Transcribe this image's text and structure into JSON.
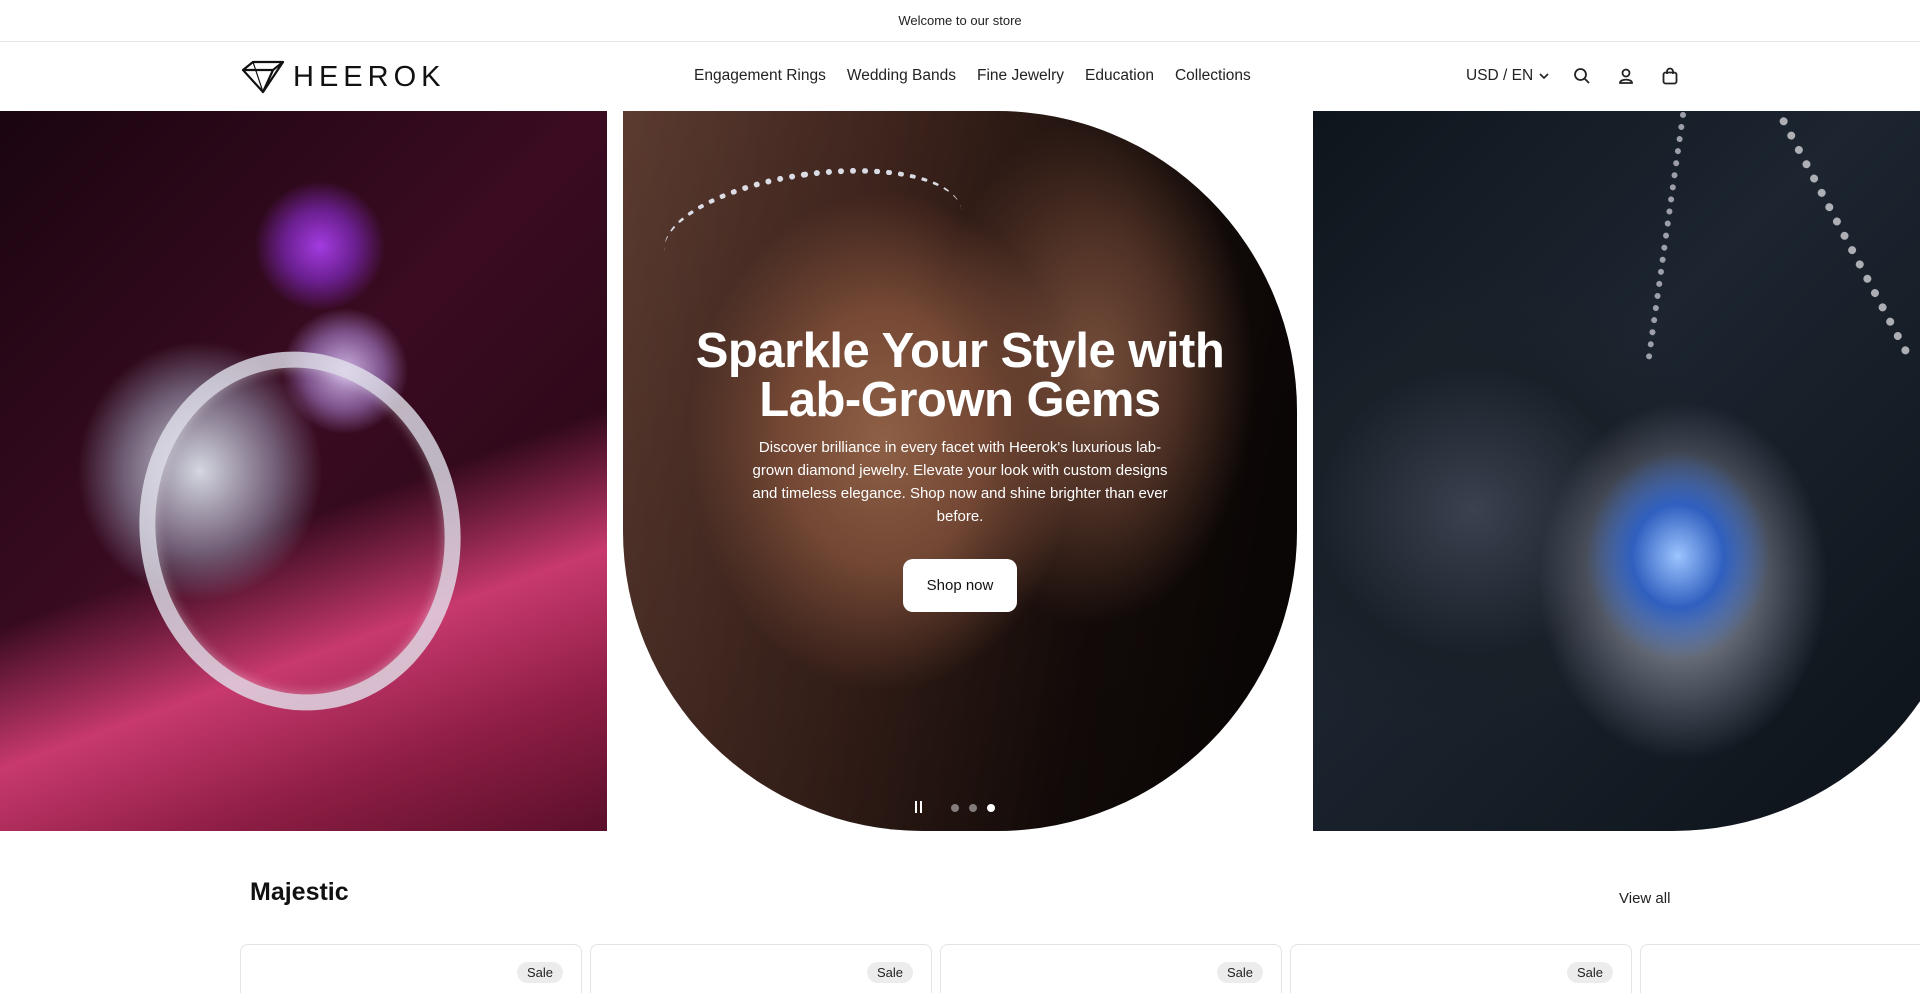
{
  "announcement": {
    "text": "Welcome to our store"
  },
  "header": {
    "logo_text": "HEEROK",
    "nav": [
      {
        "label": "Engagement Rings"
      },
      {
        "label": "Wedding Bands"
      },
      {
        "label": "Fine Jewelry"
      },
      {
        "label": "Education"
      },
      {
        "label": "Collections"
      }
    ],
    "locale": "USD / EN",
    "icons": [
      "chevron-down-icon",
      "search-icon",
      "account-icon",
      "cart-icon"
    ]
  },
  "hero": {
    "heading": "Sparkle Your Style with Lab-Grown Gems",
    "text": "Discover brilliance in every facet with Heerok's luxurious lab-grown diamond jewelry. Elevate your look with custom designs and timeless elegance. Shop now and shine brighter than ever before.",
    "button": "Shop now",
    "slides": [
      {
        "image": "pink diamond ring on satin"
      },
      {
        "image": "hand wearing tennis bracelet"
      },
      {
        "image": "sapphire teardrop pendant"
      }
    ],
    "active_dot": 3,
    "dot_count": 3
  },
  "section": {
    "title": "Majestic",
    "view_all": "View all",
    "cards": [
      {
        "badge": "Sale"
      },
      {
        "badge": "Sale"
      },
      {
        "badge": "Sale"
      },
      {
        "badge": "Sale"
      },
      {
        "badge": ""
      }
    ]
  },
  "colors": {
    "text": "#111111",
    "border": "#e6e6e6",
    "badge_bg": "#ececec"
  }
}
